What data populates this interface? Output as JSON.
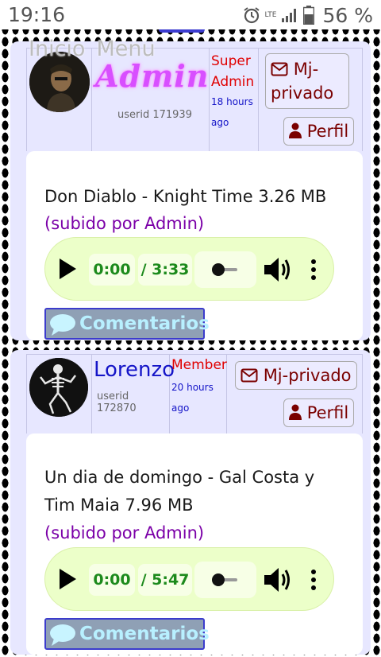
{
  "status_bar": {
    "time": "19:16",
    "network": "LTE",
    "battery": "56 %"
  },
  "nav": {
    "home": "Inicio",
    "menu": "Menu"
  },
  "posts": [
    {
      "username": "Admin",
      "userid": "userid 171939",
      "role_line1": "Super",
      "role_line2": "Admin",
      "ago_line1": "18 hours",
      "ago_line2": "ago",
      "pm_label_line1": "Mj-",
      "pm_label_line2": "privado",
      "profile_label": "Perfil",
      "title": "Don Diablo - Knight Time 3.26 MB",
      "uploader": "(subido por Admin)",
      "player": {
        "current": "0:00",
        "duration": "/ 3:33"
      },
      "comments_label": "Comentarios"
    },
    {
      "username": "Lorenzo",
      "userid": "userid 172870",
      "role_line1": "Member",
      "ago_line1": "20 hours",
      "ago_line2": "ago",
      "pm_label": "Mj-privado",
      "profile_label": "Perfil",
      "title": "Un dia de domingo - Gal Costa y Tim Maia 7.96 MB",
      "uploader": "(subido por Admin)",
      "player": {
        "current": "0:00",
        "duration": "/ 5:47"
      },
      "comments_label": "Comentarios"
    }
  ],
  "colors": {
    "card_bg": "#e7e7ff",
    "username": "#1515c8",
    "role": "#e00000",
    "uploader": "#7b00a8",
    "player_bg": "#ecffc9",
    "player_time": "#1c8a1c",
    "button_text": "#7a0000"
  }
}
